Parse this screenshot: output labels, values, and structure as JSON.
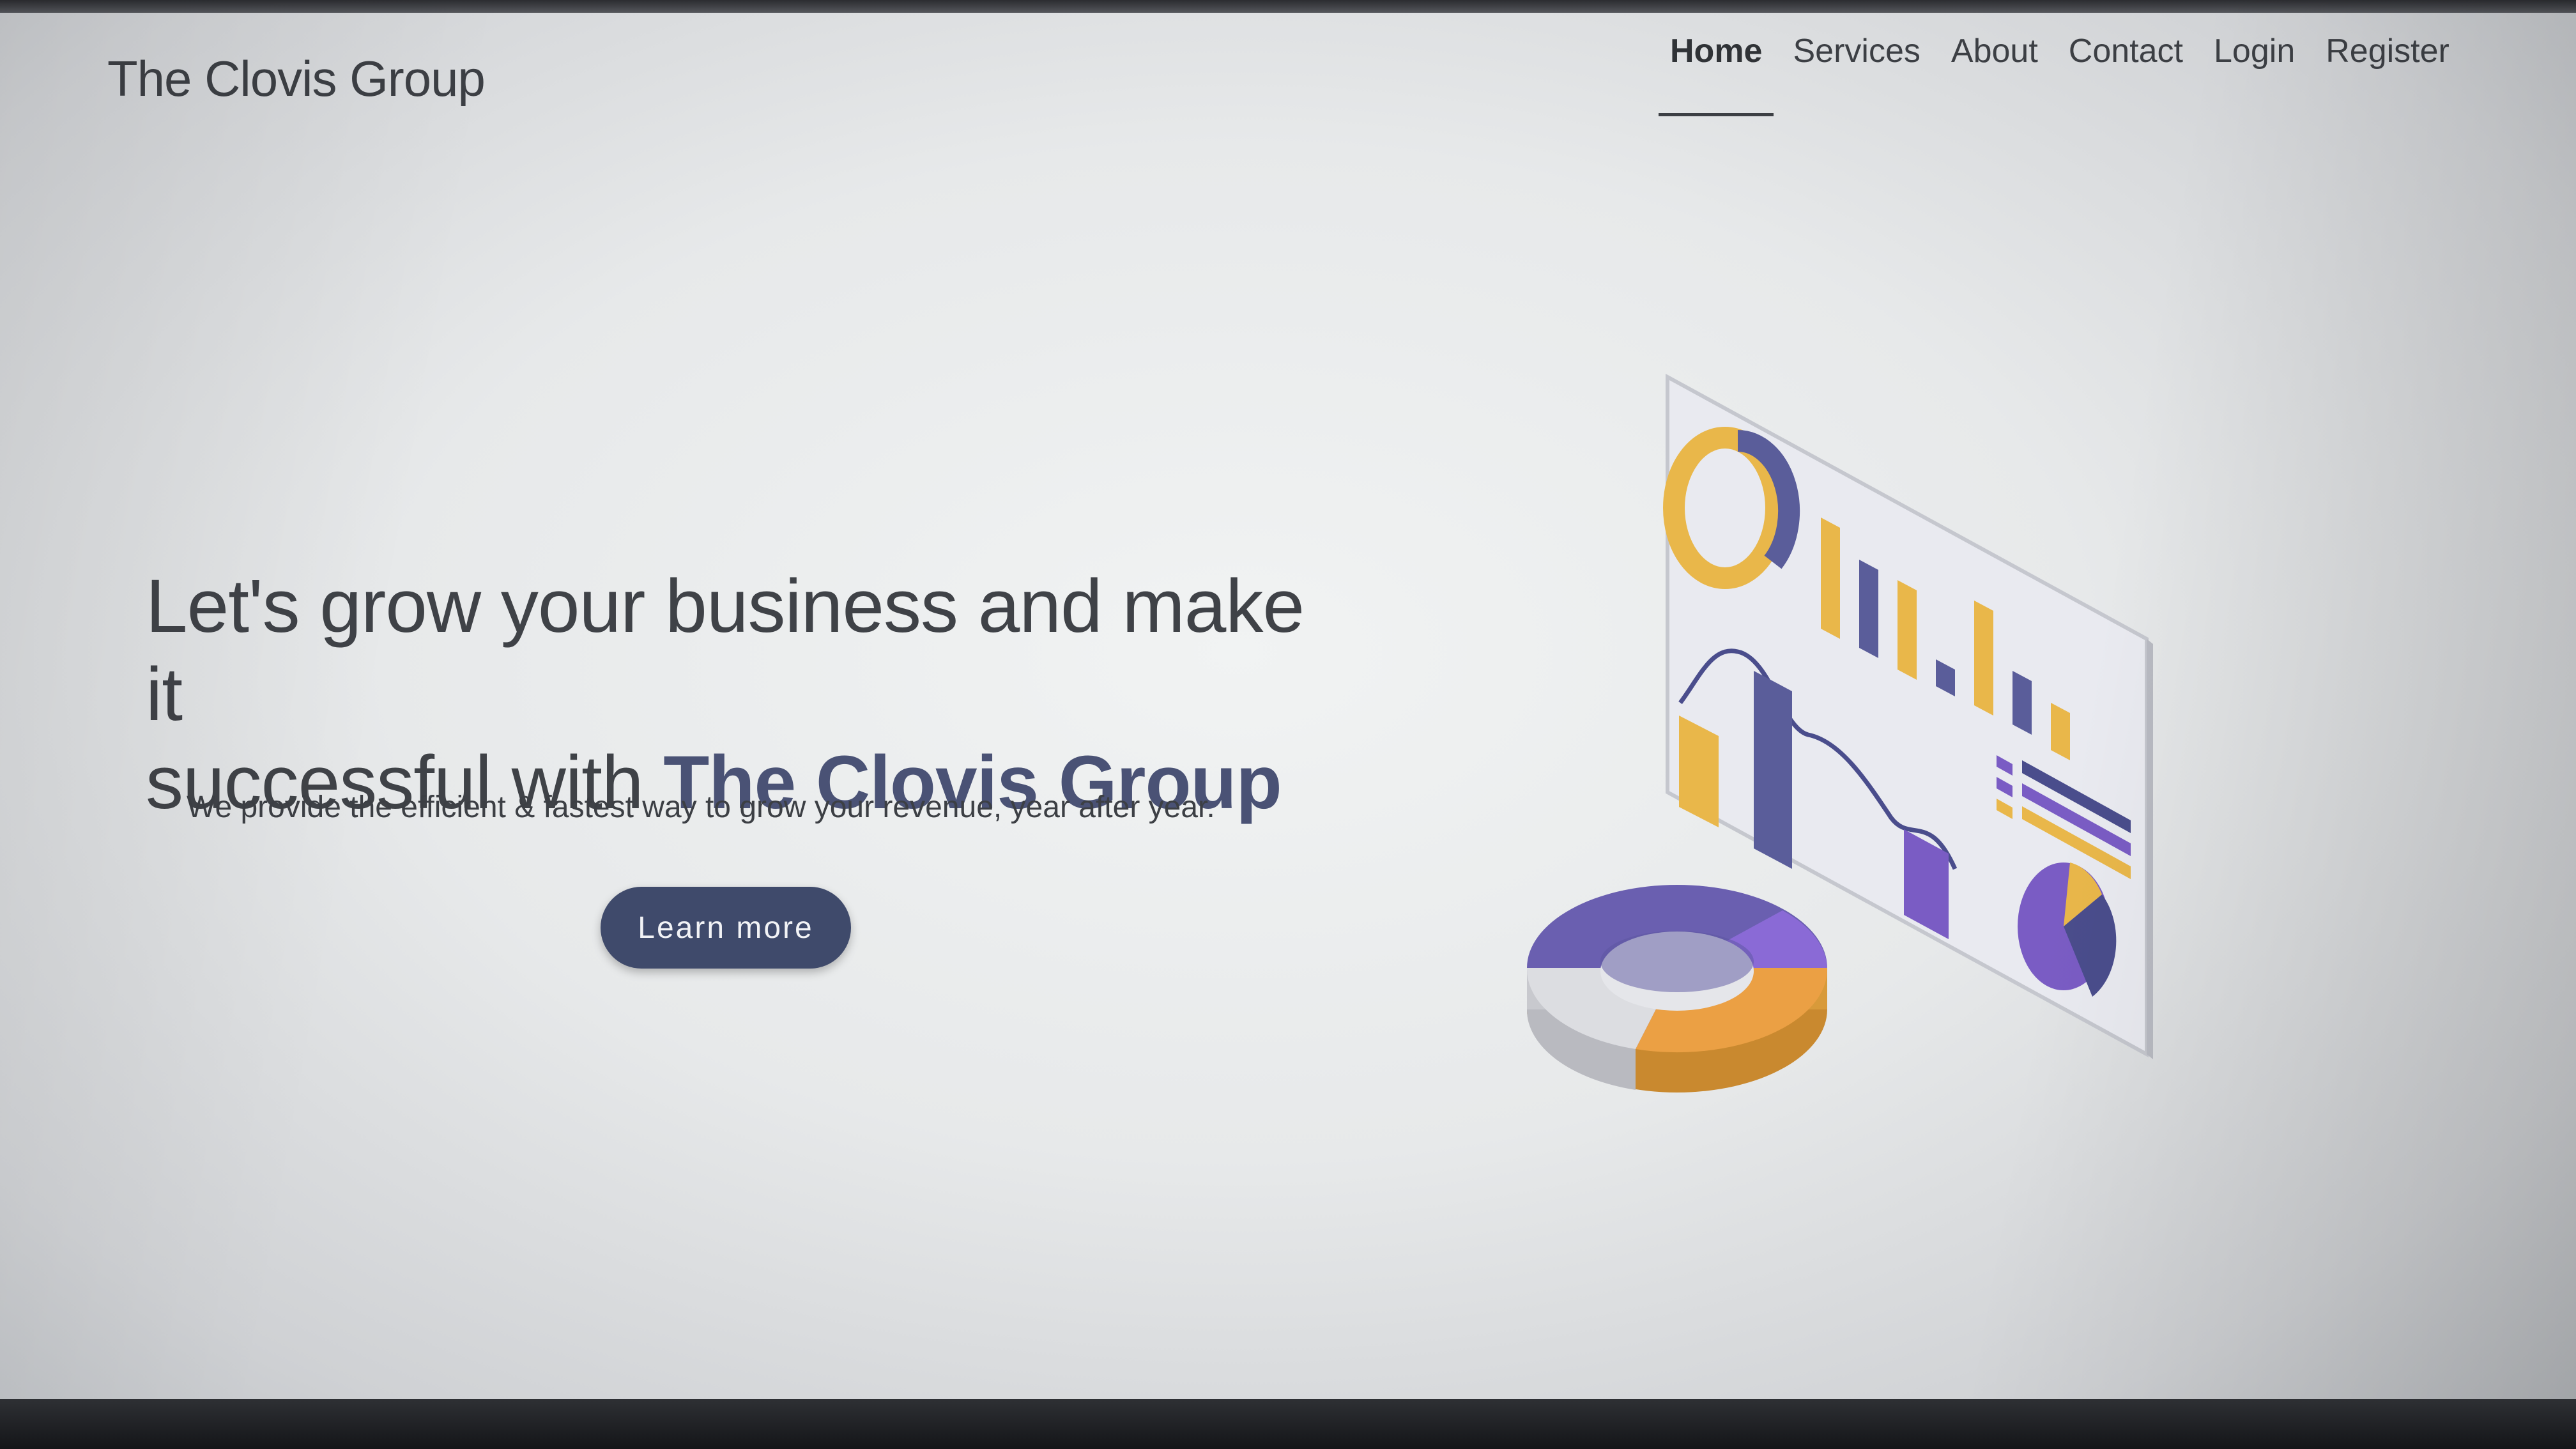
{
  "header": {
    "brand": "The Clovis Group",
    "nav": [
      {
        "label": "Home",
        "active": true
      },
      {
        "label": "Services",
        "active": false
      },
      {
        "label": "About",
        "active": false
      },
      {
        "label": "Contact",
        "active": false
      },
      {
        "label": "Login",
        "active": false
      },
      {
        "label": "Register",
        "active": false
      }
    ]
  },
  "hero": {
    "headline_line1": "Let's grow your business and make it",
    "headline_line2_prefix": "successful with ",
    "headline_brand": "The Clovis Group",
    "subtitle": "We provide the efficient & fastest way to grow your revenue, year after year.",
    "cta_label": "Learn more"
  },
  "illustration": {
    "icon": "analytics-dashboard-illustration",
    "colors": {
      "purple": "#7a5cc4",
      "navy": "#4a4d8c",
      "gold": "#e9b74a",
      "orange": "#eba044",
      "gray": "#d9dadd"
    }
  },
  "colors": {
    "accent": "#3f4a6b",
    "brand_text": "#4a5275",
    "text": "#3c3f44"
  }
}
